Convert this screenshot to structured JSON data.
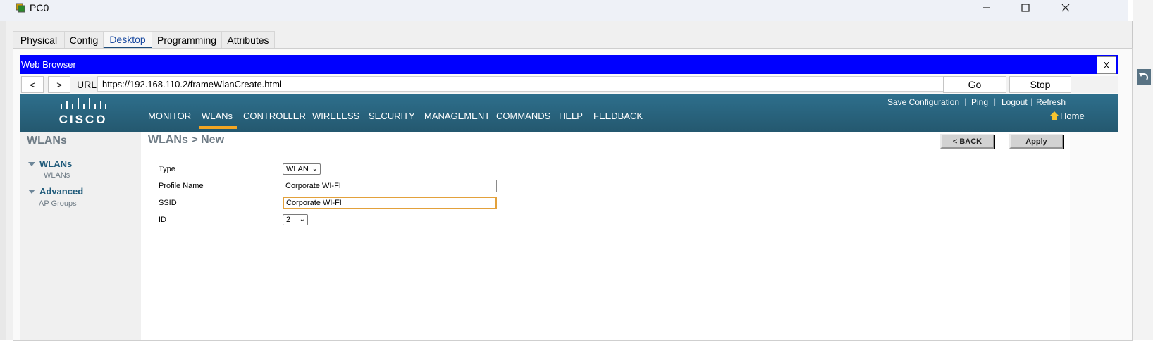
{
  "window": {
    "title": "PC0"
  },
  "tabs": [
    {
      "label": "Physical"
    },
    {
      "label": "Config"
    },
    {
      "label": "Desktop"
    },
    {
      "label": "Programming"
    },
    {
      "label": "Attributes"
    }
  ],
  "browser": {
    "title": "Web Browser",
    "close_label": "X",
    "back_label": "<",
    "forward_label": ">",
    "url_label": "URL",
    "url": "https://192.168.110.2/frameWlanCreate.html",
    "go_label": "Go",
    "stop_label": "Stop"
  },
  "controller": {
    "logo_text": "CISCO",
    "top_links": [
      "Save Configuration",
      "Ping",
      "Logout",
      "Refresh"
    ],
    "menu": [
      "MONITOR",
      "WLANs",
      "CONTROLLER",
      "WIRELESS",
      "SECURITY",
      "MANAGEMENT",
      "COMMANDS",
      "HELP",
      "FEEDBACK"
    ],
    "active_menu": "WLANs",
    "home_label": "Home"
  },
  "sidebar": {
    "title": "WLANs",
    "sections": [
      {
        "heading": "WLANs",
        "items": [
          "WLANs"
        ]
      },
      {
        "heading": "Advanced",
        "items": [
          "AP Groups"
        ]
      }
    ]
  },
  "page": {
    "heading": "WLANs > New",
    "back_button": "< BACK",
    "apply_button": "Apply",
    "fields": {
      "type_label": "Type",
      "type_value": "WLAN",
      "profile_label": "Profile Name",
      "profile_value": "Corporate WI-FI",
      "ssid_label": "SSID",
      "ssid_value": "Corporate WI-FI",
      "id_label": "ID",
      "id_value": "2"
    }
  },
  "colors": {
    "browser_titlebar": "#0000ff",
    "header": "#2e6f8c",
    "active_menu_underline": "#f5a623",
    "focus_border": "#e3a13b"
  }
}
